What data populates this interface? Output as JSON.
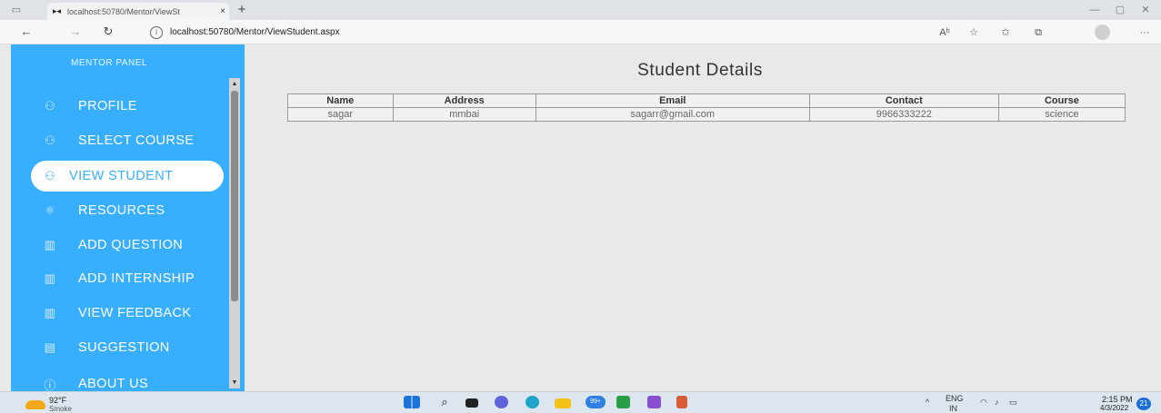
{
  "browser": {
    "tab_title": "localhost:50780/Mentor/ViewSt",
    "tab_close": "×",
    "new_tab": "+",
    "url": "localhost:50780/Mentor/ViewStudent.aspx",
    "read_aloud": "Aʰ"
  },
  "sidebar": {
    "panel_title": "MENTOR PANEL",
    "items": [
      {
        "label": "PROFILE",
        "icon": "person-icon"
      },
      {
        "label": "SELECT COURSE",
        "icon": "person-icon"
      },
      {
        "label": "VIEW STUDENT",
        "icon": "person-icon",
        "active": true
      },
      {
        "label": "RESOURCES",
        "icon": "atom-icon"
      },
      {
        "label": "ADD QUESTION",
        "icon": "map-icon"
      },
      {
        "label": "ADD INTERNSHIP",
        "icon": "map-icon"
      },
      {
        "label": "VIEW FEEDBACK",
        "icon": "map-icon"
      },
      {
        "label": "SUGGESTION",
        "icon": "note-icon"
      },
      {
        "label": "ABOUT US",
        "icon": "info-icon"
      }
    ]
  },
  "main": {
    "heading": "Student Details",
    "table": {
      "headers": [
        "Name",
        "Address",
        "Email",
        "Contact",
        "Course"
      ],
      "rows": [
        [
          "sagar",
          "mmbai",
          "sagarr@gmail.com",
          "9966333222",
          "science"
        ]
      ]
    }
  },
  "taskbar": {
    "weather_temp": "92°F",
    "weather_desc": "Smoke",
    "language": "ENG",
    "region": "IN",
    "time": "2:15 PM",
    "date": "4/3/2022",
    "notifications": "21",
    "store_badge": "99+"
  },
  "colors": {
    "sidebar": "#38aeff",
    "active_text": "#38aeff"
  }
}
